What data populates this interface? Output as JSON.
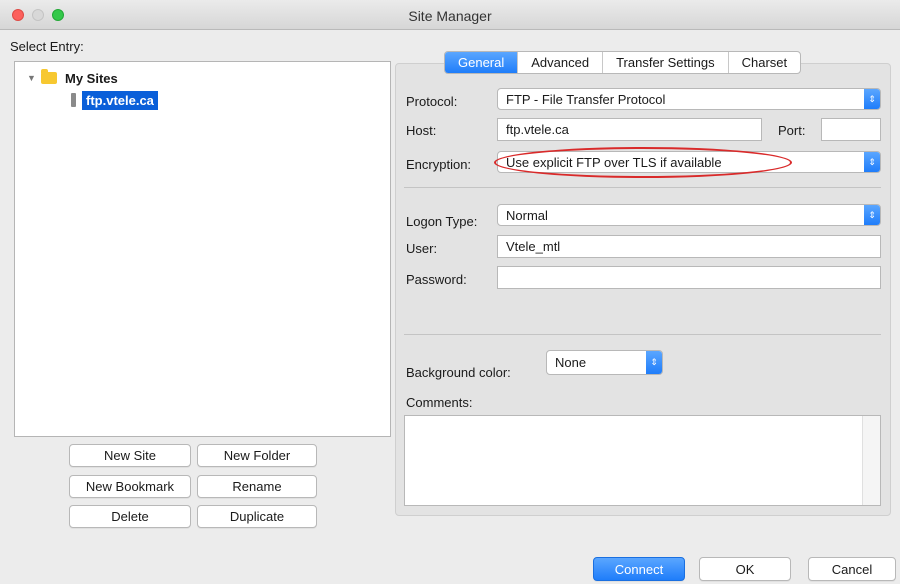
{
  "window": {
    "title": "Site Manager"
  },
  "select_entry_label": "Select Entry:",
  "tree": {
    "folder": "My Sites",
    "site": "ftp.vtele.ca"
  },
  "left_buttons": {
    "new_site": "New Site",
    "new_folder": "New Folder",
    "new_bookmark": "New Bookmark",
    "rename": "Rename",
    "delete": "Delete",
    "duplicate": "Duplicate"
  },
  "tabs": [
    {
      "label": "General",
      "active": true
    },
    {
      "label": "Advanced",
      "active": false
    },
    {
      "label": "Transfer Settings",
      "active": false
    },
    {
      "label": "Charset",
      "active": false
    }
  ],
  "general": {
    "protocol_label": "Protocol:",
    "protocol_value": "FTP - File Transfer Protocol",
    "host_label": "Host:",
    "host_value": "ftp.vtele.ca",
    "port_label": "Port:",
    "port_value": "",
    "encryption_label": "Encryption:",
    "encryption_value": "Use explicit FTP over TLS if available",
    "logon_label": "Logon Type:",
    "logon_value": "Normal",
    "user_label": "User:",
    "user_value": "Vtele_mtl",
    "password_label": "Password:",
    "password_value": "",
    "bg_label": "Background color:",
    "bg_value": "None",
    "comments_label": "Comments:",
    "comments_value": ""
  },
  "bottom_buttons": {
    "connect": "Connect",
    "ok": "OK",
    "cancel": "Cancel"
  },
  "colors": {
    "accent": "#1f7dfa",
    "highlight_oval": "#d92a2a",
    "selection": "#0a5fd9"
  },
  "icons": [
    "folder-icon",
    "site-icon",
    "disclosure-triangle-icon",
    "stepper-icon"
  ]
}
